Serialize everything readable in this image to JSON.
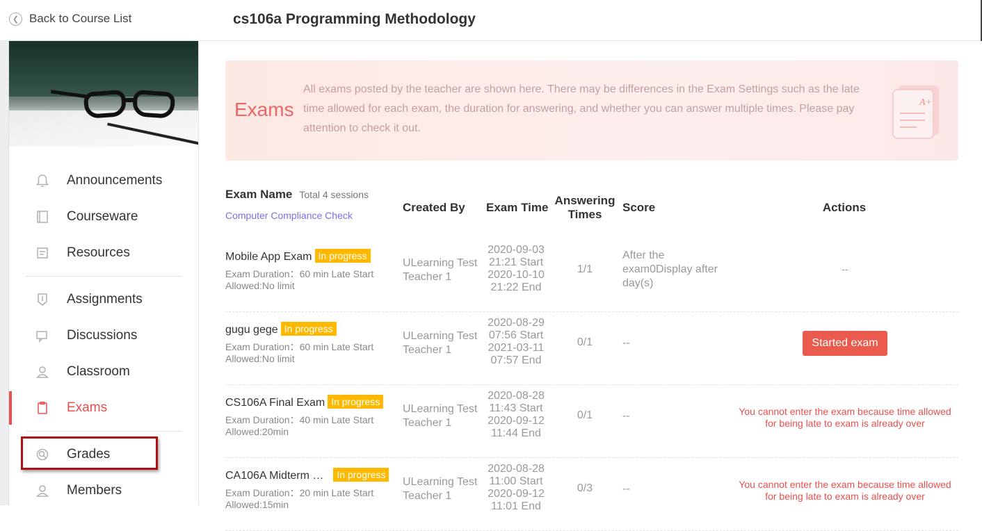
{
  "header": {
    "back_label": "Back to Course List",
    "course_title": "cs106a Programming Methodology"
  },
  "sidebar": {
    "items": [
      {
        "label": "Announcements",
        "icon": "bell-icon"
      },
      {
        "label": "Courseware",
        "icon": "book-icon"
      },
      {
        "label": "Resources",
        "icon": "folder-icon"
      },
      {
        "label": "Assignments",
        "icon": "shield-icon"
      },
      {
        "label": "Discussions",
        "icon": "chat-icon"
      },
      {
        "label": "Classroom",
        "icon": "person-icon"
      },
      {
        "label": "Exams",
        "icon": "clipboard-icon",
        "active": true
      },
      {
        "label": "Grades",
        "icon": "magnifier-icon"
      },
      {
        "label": "Members",
        "icon": "person-icon"
      }
    ]
  },
  "banner": {
    "title": "Exams",
    "description": "All exams posted by the teacher are shown here. There may be differences in the Exam Settings such as the late time allowed for each exam, the duration for answering, and whether you can answer multiple times. Please pay attention to check it out."
  },
  "table": {
    "headers": {
      "name": "Exam Name",
      "total": "Total 4 sessions",
      "compliance_check": "Computer Compliance Check",
      "created_by": "Created By",
      "exam_time": "Exam Time",
      "answering_times": "Answering Times",
      "score": "Score",
      "actions": "Actions"
    },
    "rows": [
      {
        "name": "Mobile App Exam",
        "status": "In progress",
        "meta": "Exam Duration：60 min Late Start Allowed:No limit",
        "creator": "ULearning Test Teacher 1",
        "start": "2020-09-03 21:21 Start",
        "end": "2020-10-10 21:22 End",
        "answering": "1/1",
        "score": "After the exam0Display after day(s)",
        "action": "--"
      },
      {
        "name": "gugu gege",
        "status": "In progress",
        "meta": "Exam Duration：60 min Late Start Allowed:No limit",
        "creator": "ULearning Test Teacher 1",
        "start": "2020-08-29 07:56 Start",
        "end": "2021-03-11 07:57 End",
        "answering": "0/1",
        "score": "--",
        "action_button": "Started exam"
      },
      {
        "name": "CS106A Final Exam",
        "status": "In progress",
        "meta": "Exam Duration：40 min Late Start Allowed:20min",
        "creator": "ULearning Test Teacher 1",
        "start": "2020-08-28 11:43 Start",
        "end": "2020-09-12 11:44 End",
        "answering": "0/1",
        "score": "--",
        "action_warning": "You cannot enter the exam because time allowed for being late to exam is already over"
      },
      {
        "name": "CA106A Midterm …",
        "status": "In progress",
        "meta": "Exam Duration：20 min Late Start Allowed:15min",
        "creator": "ULearning Test Teacher 1",
        "start": "2020-08-28 11:00 Start",
        "end": "2020-09-12 11:01 End",
        "answering": "0/3",
        "score": "--",
        "action_warning": "You cannot enter the exam because time allowed for being late to exam is already over"
      }
    ]
  },
  "colors": {
    "accent": "#e84f4f",
    "badge": "#ffb800",
    "link": "#7b6fe0",
    "highlight_box": "#b00f16"
  }
}
